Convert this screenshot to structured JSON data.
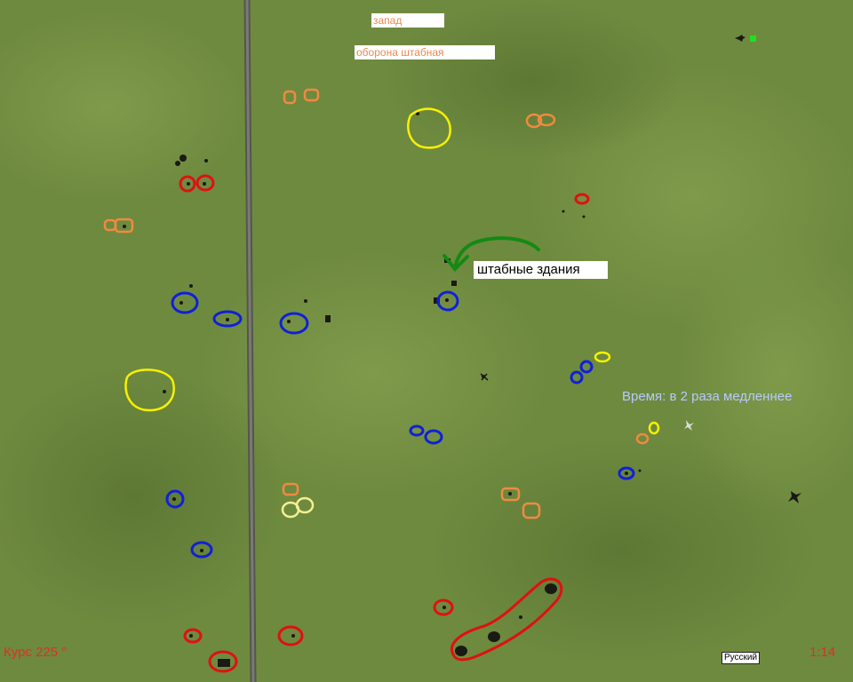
{
  "labels": {
    "west": "запад",
    "defense": "оборона штабная",
    "hq_buildings": "штабные здания"
  },
  "hud": {
    "heading": "Курс 225 °",
    "time": "1:14",
    "speed": "Время: в 2 раза медленнее",
    "language": "Русский"
  },
  "colors": {
    "grass": "#6e8a3f",
    "road": "#6a6a6a",
    "marker_red": "#e01010",
    "marker_blue": "#1020d8",
    "marker_orange": "#f08a40",
    "marker_yellow": "#f8f000",
    "marker_pale_yellow": "#f4f090",
    "arrow_green": "#138a13",
    "hud_red": "#e03020",
    "hud_speed": "#b8c8ff",
    "label_orange": "#e88a50",
    "status_green": "#22dd22"
  }
}
